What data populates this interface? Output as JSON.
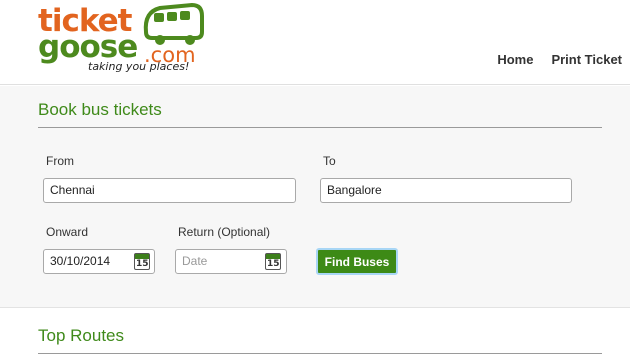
{
  "logo": {
    "ticket": "ticket",
    "goose": "goose",
    "com": ".com",
    "tagline": "taking you places!"
  },
  "nav": {
    "home": "Home",
    "print_ticket": "Print Ticket"
  },
  "booking": {
    "title": "Book bus tickets",
    "from_label": "From",
    "from_value": "Chennai",
    "to_label": "To",
    "to_value": "Bangalore",
    "onward_label": "Onward",
    "onward_value": "30/10/2014",
    "return_label": "Return (Optional)",
    "return_placeholder": "Date",
    "calendar_day": "15",
    "find_button": "Find Buses"
  },
  "routes": {
    "title": "Top Routes"
  },
  "colors": {
    "brand_green": "#3f8a1a",
    "brand_orange": "#e2641f",
    "button_bg": "#3d8a16"
  }
}
